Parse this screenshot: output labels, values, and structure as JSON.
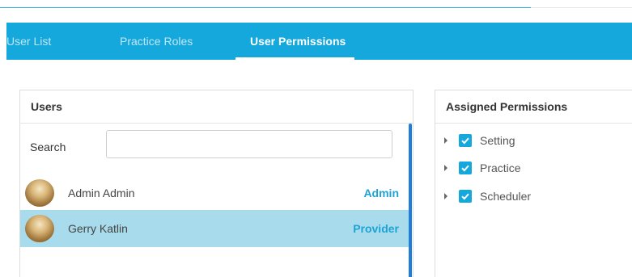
{
  "tabs": [
    {
      "label": "User List",
      "active": false
    },
    {
      "label": "Practice Roles",
      "active": false
    },
    {
      "label": "User Permissions",
      "active": true
    }
  ],
  "users_panel": {
    "title": "Users",
    "search_label": "Search",
    "search_value": "",
    "search_placeholder": "",
    "users": [
      {
        "name": "Admin Admin",
        "role": "Admin",
        "selected": false,
        "avatar_icon": "user-avatar-photo"
      },
      {
        "name": "Gerry Katlin",
        "role": "Provider",
        "selected": true,
        "avatar_icon": "user-avatar-photo"
      }
    ]
  },
  "permissions_panel": {
    "title": "Assigned Permissions",
    "items": [
      {
        "label": "Setting",
        "checked": true,
        "expand_icon": "caret-right-icon"
      },
      {
        "label": "Practice",
        "checked": true,
        "expand_icon": "caret-right-icon"
      },
      {
        "label": "Scheduler",
        "checked": true,
        "expand_icon": "caret-right-icon"
      }
    ]
  },
  "colors": {
    "tab_bar": "#14a8dc",
    "selected_row": "#a8dcec",
    "role_text": "#1fa3d6",
    "checkbox": "#14a8dc",
    "scrollbar": "#1f7ddb"
  }
}
